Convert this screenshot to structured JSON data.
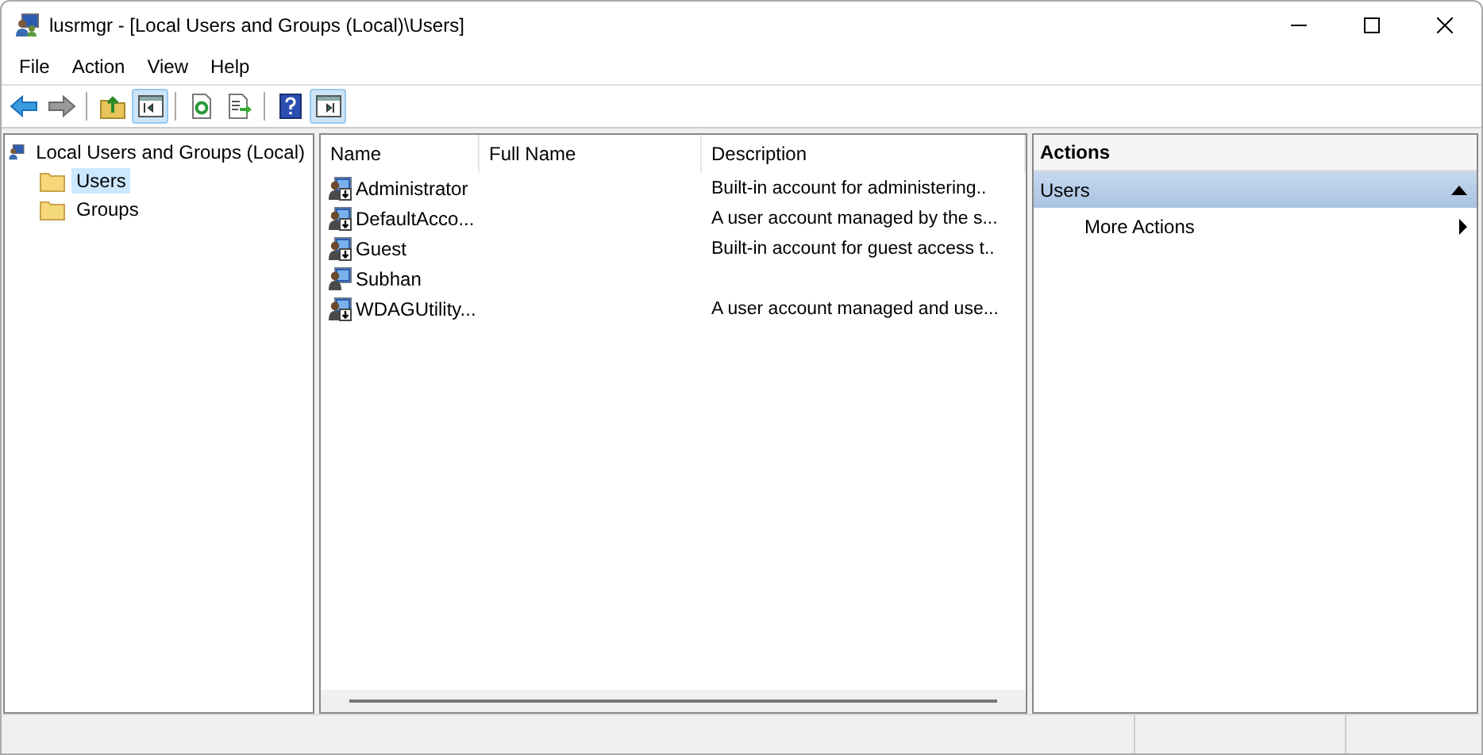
{
  "window": {
    "title": "lusrmgr - [Local Users and Groups (Local)\\Users]"
  },
  "menu": [
    "File",
    "Action",
    "View",
    "Help"
  ],
  "toolbar": [
    {
      "kind": "back",
      "pressed": false
    },
    {
      "kind": "forward",
      "pressed": false
    },
    {
      "kind": "up",
      "pressed": false
    },
    {
      "kind": "tree",
      "pressed": true
    },
    {
      "kind": "refresh",
      "pressed": false
    },
    {
      "kind": "export",
      "pressed": false
    },
    {
      "kind": "help",
      "pressed": false
    },
    {
      "kind": "actionpane",
      "pressed": true
    }
  ],
  "tree": {
    "label": "Local Users and Groups (Local)",
    "children": [
      {
        "label": "Users",
        "selected": true
      },
      {
        "label": "Groups",
        "selected": false
      }
    ]
  },
  "table": {
    "columns": [
      "Name",
      "Full Name",
      "Description"
    ],
    "rows": [
      {
        "name": "Administrator",
        "full_name": "",
        "description": "Built-in account for administering..",
        "disabled": true
      },
      {
        "name": "DefaultAcco...",
        "full_name": "",
        "description": "A user account managed by the s...",
        "disabled": true
      },
      {
        "name": "Guest",
        "full_name": "",
        "description": "Built-in account for guest access t..",
        "disabled": true
      },
      {
        "name": "Subhan",
        "full_name": "",
        "description": "",
        "disabled": false
      },
      {
        "name": "WDAGUtility...",
        "full_name": "",
        "description": "A user account managed and use...",
        "disabled": true
      }
    ]
  },
  "actions": {
    "title": "Actions",
    "sections": [
      {
        "label": "Users",
        "expanded": true,
        "items": [
          "More Actions"
        ]
      }
    ]
  }
}
